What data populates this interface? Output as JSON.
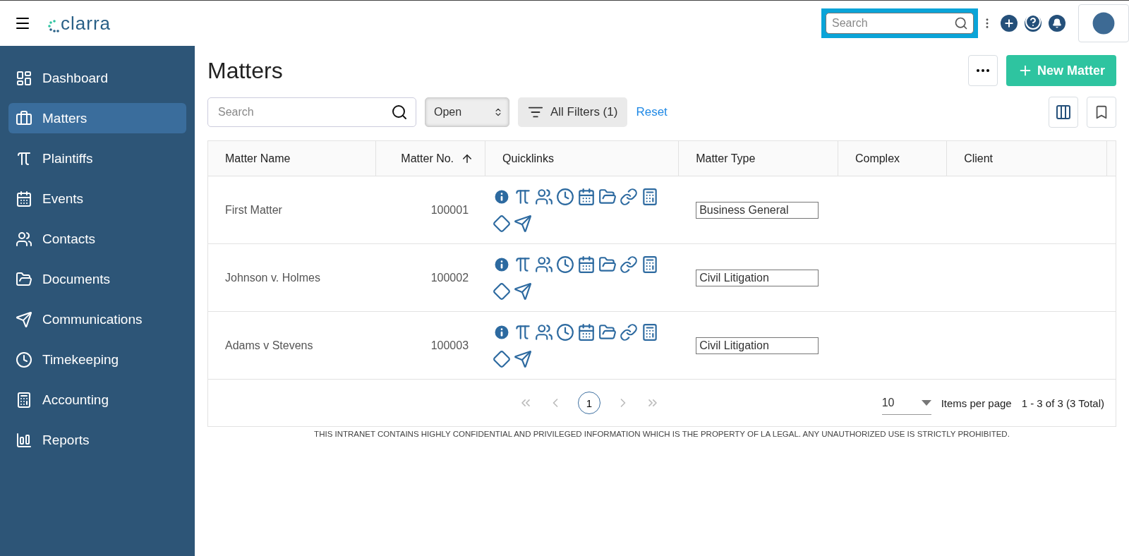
{
  "topbar": {
    "logo": "clarra",
    "search": {
      "placeholder": "Search",
      "highlighted": true
    }
  },
  "sidebar": {
    "items": [
      {
        "label": "Dashboard",
        "selected": false
      },
      {
        "label": "Matters",
        "selected": true
      },
      {
        "label": "Plaintiffs",
        "selected": false
      },
      {
        "label": "Events",
        "selected": false
      },
      {
        "label": "Contacts",
        "selected": false
      },
      {
        "label": "Documents",
        "selected": false
      },
      {
        "label": "Communications",
        "selected": false
      },
      {
        "label": "Timekeeping",
        "selected": false
      },
      {
        "label": "Accounting",
        "selected": false
      },
      {
        "label": "Reports",
        "selected": false
      }
    ]
  },
  "page": {
    "title": "Matters",
    "new_button": "New Matter"
  },
  "filters": {
    "search_placeholder": "Search",
    "status": "Open",
    "filters_button": "All Filters (1)",
    "reset": "Reset"
  },
  "table": {
    "columns": [
      {
        "label": "Matter Name",
        "sorted": false
      },
      {
        "label": "Matter No.",
        "sorted": true
      },
      {
        "label": "Quicklinks",
        "sorted": false
      },
      {
        "label": "Matter Type",
        "sorted": false
      },
      {
        "label": "Complex",
        "sorted": false
      },
      {
        "label": "Client",
        "sorted": false
      }
    ],
    "rows": [
      {
        "name": "First Matter",
        "number": "100001",
        "type": "Business General"
      },
      {
        "name": "Johnson v. Holmes",
        "number": "100002",
        "type": "Civil Litigation"
      },
      {
        "name": "Adams v Stevens",
        "number": "100003",
        "type": "Civil Litigation"
      }
    ]
  },
  "pagination": {
    "pages": [
      {
        "label": "1",
        "selected": true
      }
    ],
    "page_size": "10",
    "page_size_label": "Items per page",
    "range": "1 - 3 of 3 (3 Total)"
  },
  "disclaimer": "THIS INTRANET CONTAINS HIGHLY CONFIDENTIAL AND PRIVILEGED INFORMATION WHICH IS THE PROPERTY OF LA LEGAL. ANY UNAUTHORIZED USE IS STRICTLY PROHIBITED."
}
